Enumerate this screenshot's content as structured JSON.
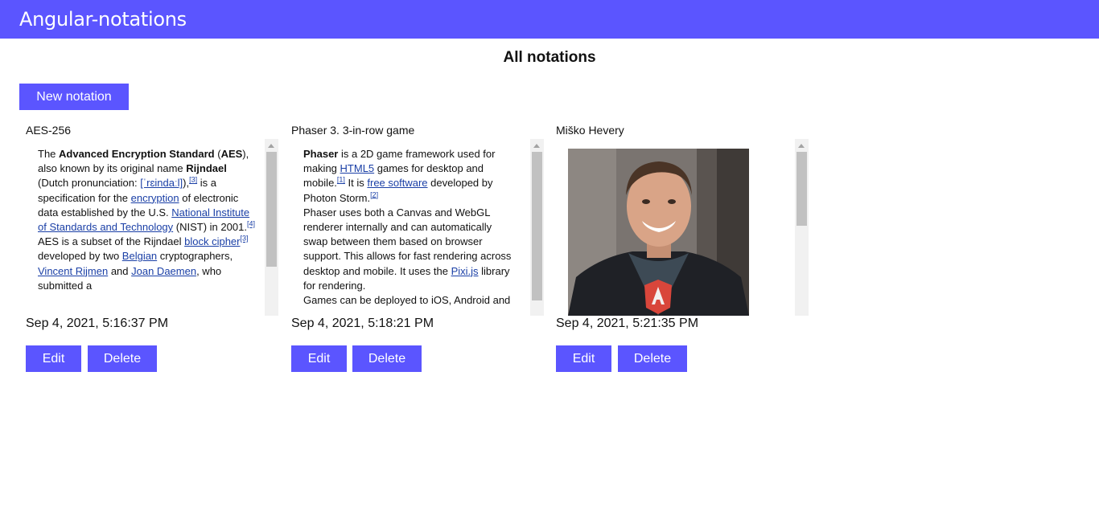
{
  "app": {
    "title": "Angular-notations"
  },
  "page": {
    "heading": "All notations",
    "new_button": "New notation"
  },
  "colors": {
    "accent": "#5b55ff",
    "link": "#1a3fa6"
  },
  "notations": [
    {
      "title": "AES-256",
      "date": "Sep 4, 2021, 5:16:37 PM",
      "edit_label": "Edit",
      "delete_label": "Delete",
      "body": {
        "t1": "The ",
        "b1": "Advanced Encryption Standard",
        "t2": " (",
        "b2": "AES",
        "t3": "), also known by its original name ",
        "b3": "Rijndael",
        "t4": " (Dutch pronunciation: ",
        "l1": "[ˈrɛindaːl]",
        "t5": "),",
        "s1": "[3]",
        "t6": " is a specification for the ",
        "l2": "encryption",
        "t7": " of electronic data established by the U.S. ",
        "l3": "National Institute of Standards and Technology",
        "t8": " (NIST) in 2001.",
        "s2": "[4]",
        "t9": "AES is a subset of the Rijndael ",
        "l4": "block cipher",
        "s3": "[3]",
        "t10": " developed by two ",
        "l5": "Belgian",
        "t11": " cryptographers, ",
        "l6": "Vincent Rijmen",
        "t12": " and ",
        "l7": "Joan Daemen",
        "t13": ", who submitted a"
      },
      "scroll_fraction": 0.0
    },
    {
      "title": "Phaser 3. 3-in-row game",
      "date": "Sep 4, 2021, 5:18:21 PM",
      "edit_label": "Edit",
      "delete_label": "Delete",
      "body": {
        "b1": "Phaser",
        "t1": " is a 2D game framework used for making ",
        "l1": "HTML5",
        "t2": " games for desktop and mobile.",
        "s1": "[1]",
        "t3": " It is ",
        "l2": "free software",
        "t4": " developed by Photon Storm.",
        "s2": "[2]",
        "t5": "Phaser uses both a Canvas and WebGL renderer internally and can automatically swap between them based on browser support. This allows for fast rendering across desktop and mobile. It uses the ",
        "l3": "Pixi.js",
        "t6": " library for rendering.",
        "t7": "Games can be deployed to iOS, Android and"
      },
      "scroll_fraction": 0.0
    },
    {
      "title": "Miško Hevery",
      "date": "Sep 4, 2021, 5:21:35 PM",
      "edit_label": "Edit",
      "delete_label": "Delete",
      "image_name": "portrait-photo",
      "scroll_fraction": 0.0
    }
  ]
}
